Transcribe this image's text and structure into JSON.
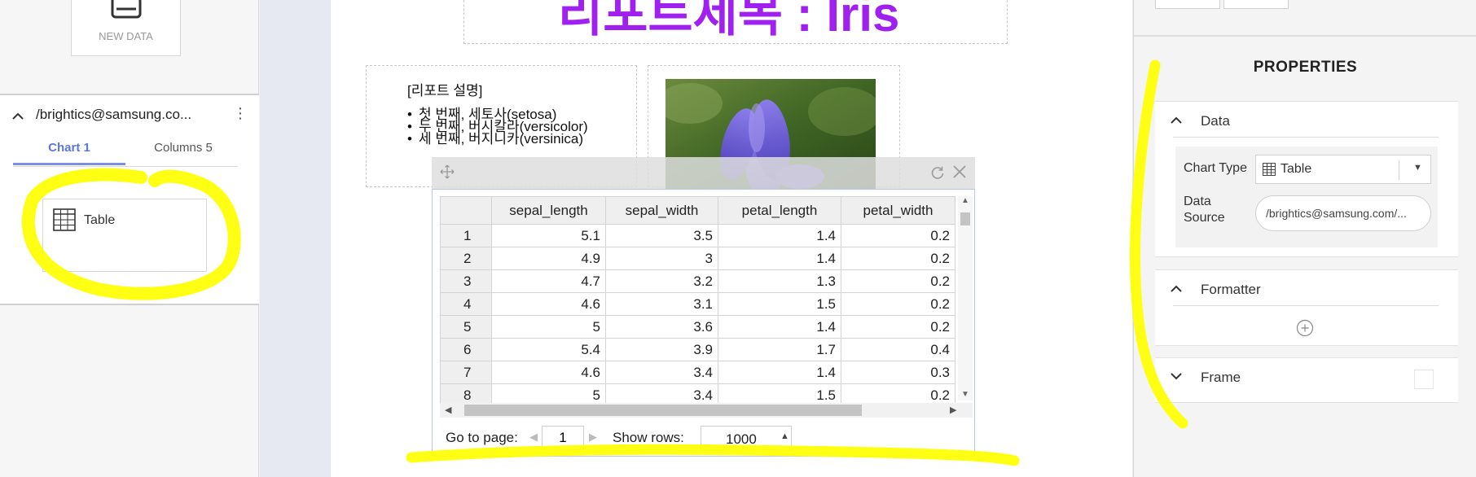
{
  "left_panel": {
    "new_data_label": "NEW DATA",
    "datasource_title": "/brightics@samsung.co...",
    "tabs": [
      "Chart 1",
      "Columns 5"
    ],
    "chart_item_label": "Table"
  },
  "report": {
    "title": "리포트제목 : Iris",
    "description_title": "[리포트 설명]",
    "description_items": [
      "첫 번째, 세토사(setosa)",
      "두 번째, 버시칼라(versicolor)",
      "세 번째, 버지니카(versinica)"
    ]
  },
  "table": {
    "columns": [
      "",
      "sepal_length",
      "sepal_width",
      "petal_length",
      "petal_width"
    ],
    "rows": [
      [
        "1",
        "5.1",
        "3.5",
        "1.4",
        "0.2"
      ],
      [
        "2",
        "4.9",
        "3",
        "1.4",
        "0.2"
      ],
      [
        "3",
        "4.7",
        "3.2",
        "1.3",
        "0.2"
      ],
      [
        "4",
        "4.6",
        "3.1",
        "1.5",
        "0.2"
      ],
      [
        "5",
        "5",
        "3.6",
        "1.4",
        "0.2"
      ],
      [
        "6",
        "5.4",
        "3.9",
        "1.7",
        "0.4"
      ],
      [
        "7",
        "4.6",
        "3.4",
        "1.4",
        "0.3"
      ],
      [
        "8",
        "5",
        "3.4",
        "1.5",
        "0.2"
      ]
    ],
    "pager": {
      "goto_label": "Go to page:",
      "page_value": "1",
      "rows_label": "Show rows:",
      "rows_value": "1000"
    }
  },
  "properties": {
    "title": "PROPERTIES",
    "data_section": "Data",
    "chart_type_label": "Chart Type",
    "chart_type_value": "Table",
    "data_source_label": "Data Source",
    "data_source_value": "/brightics@samsung.com/...",
    "formatter_section": "Formatter",
    "frame_section": "Frame"
  },
  "colors": {
    "title_purple": "#a020f0",
    "tab_active": "#5b78d6",
    "highlight_yellow": "#ffff00"
  }
}
